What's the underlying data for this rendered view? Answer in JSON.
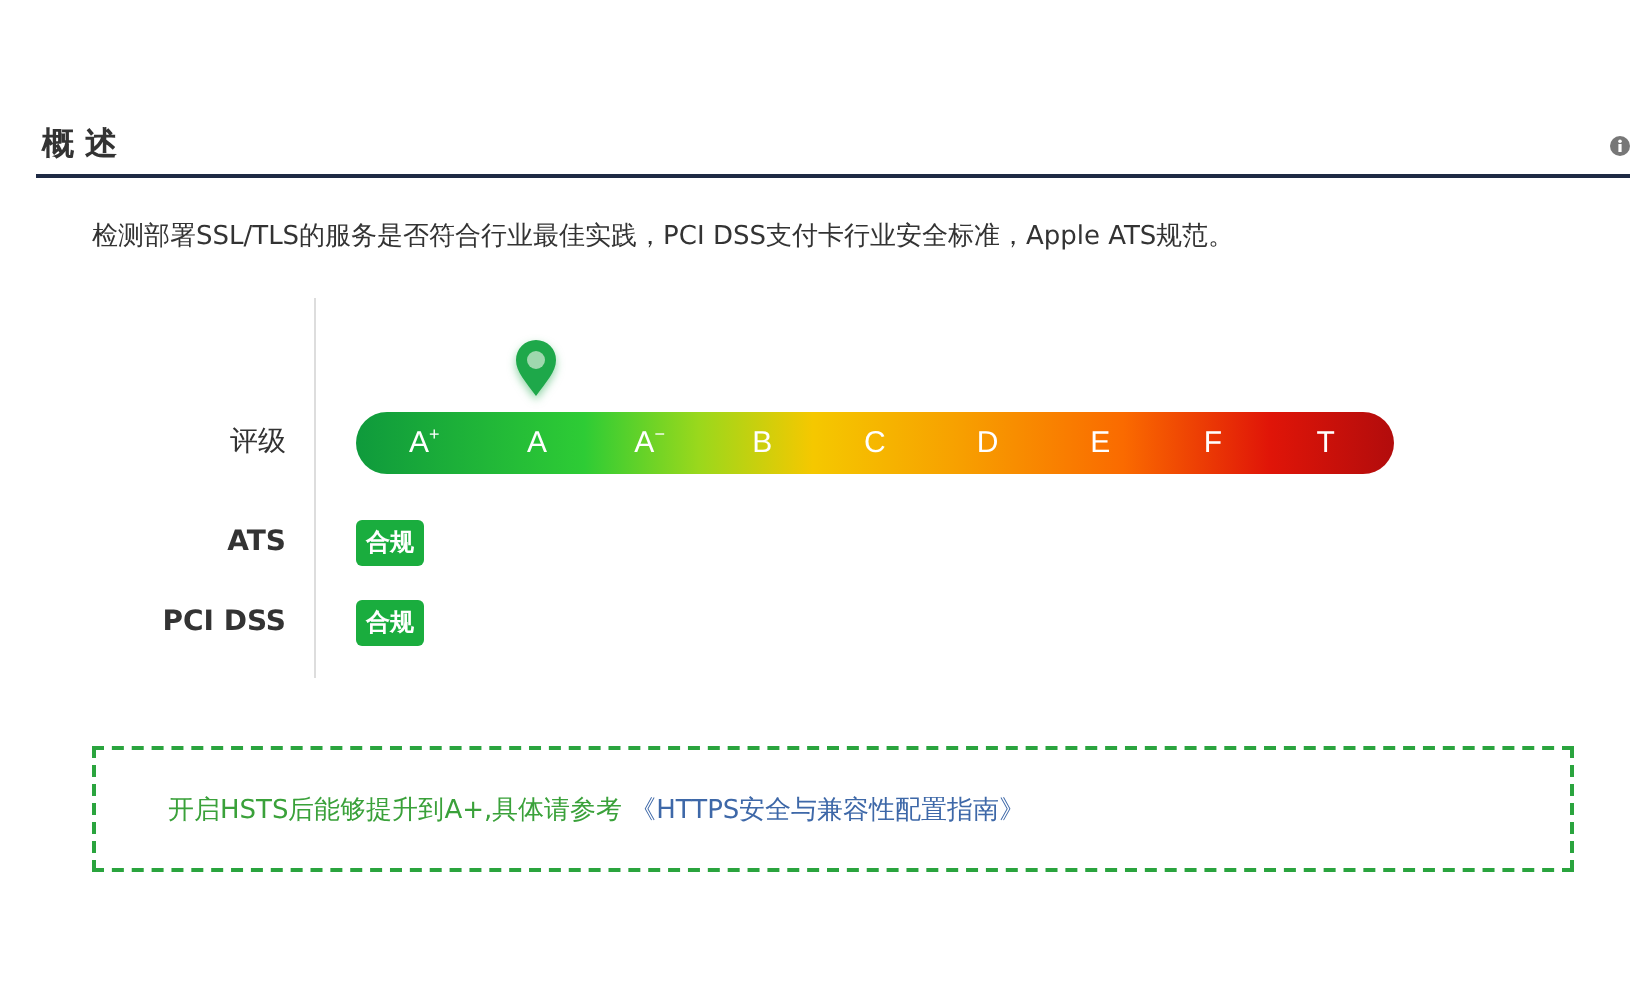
{
  "section": {
    "title": "概 述",
    "description": "检测部署SSL/TLS的服务是否符合行业最佳实践，PCI DSS支付卡行业安全标准，Apple ATS规范。"
  },
  "rating": {
    "label": "评级",
    "grades": [
      {
        "text": "A$^{+}$",
        "selected": false
      },
      {
        "text": "A",
        "selected": true
      },
      {
        "text": "A$^{−}$",
        "selected": false
      },
      {
        "text": "B",
        "selected": false
      },
      {
        "text": "C",
        "selected": false
      },
      {
        "text": "D",
        "selected": false
      },
      {
        "text": "E",
        "selected": false
      },
      {
        "text": "F",
        "selected": false
      },
      {
        "text": "T",
        "selected": false
      }
    ]
  },
  "compliance": [
    {
      "label": "ATS",
      "badge": "合规"
    },
    {
      "label": "PCI DSS",
      "badge": "合规"
    }
  ],
  "notice": {
    "text": "开启HSTS后能够提升到A+,具体请参考",
    "link": "《HTTPS安全与兼容性配置指南》"
  }
}
